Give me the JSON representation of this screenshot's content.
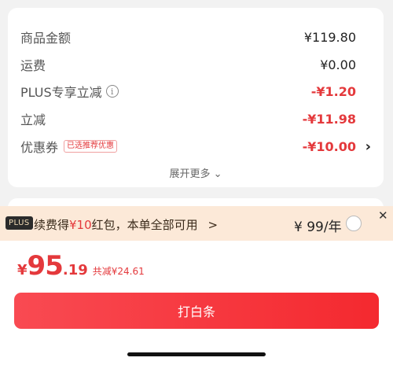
{
  "summary": {
    "rows": [
      {
        "label": "商品金额",
        "value": "¥119.80"
      },
      {
        "label": "运费",
        "value": "¥0.00"
      },
      {
        "label": "PLUS专享立减",
        "value": "-¥1.20"
      },
      {
        "label": "立减",
        "value": "-¥11.98"
      },
      {
        "label": "优惠券",
        "value": "-¥10.00",
        "tag": "已选推荐优惠"
      }
    ],
    "expand_label": "展开更多",
    "info_icon_glyph": "i"
  },
  "plus_bar": {
    "badge": "PLUS",
    "text_prefix": "续费得",
    "text_highlight": "¥10",
    "text_suffix": "红包，本单全部可用",
    "chevron": ">",
    "price": "¥ 99/年",
    "close_glyph": "✕"
  },
  "total": {
    "yen": "¥",
    "integer": "95",
    "decimal": ".19",
    "saving": "共减¥24.61"
  },
  "pay_button_label": "打白条",
  "colors": {
    "accent_red": "#e4393c",
    "plus_bar_bg": "#fce9d8",
    "button_start": "#f94a52",
    "button_end": "#f4292f"
  }
}
